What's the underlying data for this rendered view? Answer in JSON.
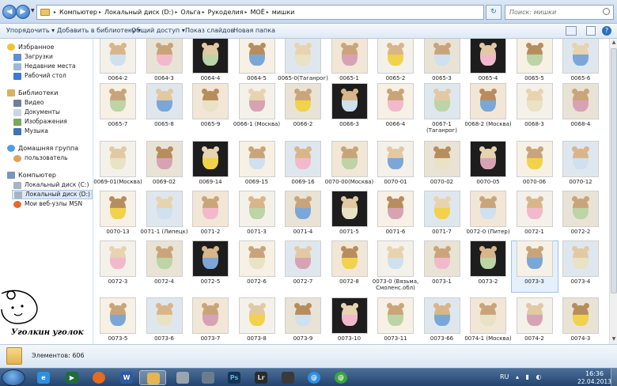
{
  "address": {
    "breadcrumbs": [
      "Компьютер",
      "Локальный диск (D:)",
      "Ольга",
      "Рукоделия",
      "МОЁ",
      "мишки"
    ],
    "search_placeholder": "Поиск: мишки"
  },
  "toolbar": {
    "organize": "Упорядочить ▾",
    "add_to_library": "Добавить в библиотеку ▾",
    "share": "Общий доступ ▾",
    "slideshow": "Показ слайдов",
    "new_folder": "Новая папка"
  },
  "nav": {
    "favorites": {
      "title": "Избранное",
      "items": [
        "Загрузки",
        "Недавние места",
        "Рабочий стол"
      ]
    },
    "libraries": {
      "title": "Библиотеки",
      "items": [
        "Видео",
        "Документы",
        "Изображения",
        "Музыка"
      ]
    },
    "homegroup": {
      "title": "Домашняя группа",
      "items": [
        "пользователь"
      ]
    },
    "computer": {
      "title": "Компьютер",
      "items": [
        "Локальный диск (C:)",
        "Локальный диск (D:)",
        "Мои веб-узлы MSN"
      ]
    }
  },
  "sticker": {
    "text": "Уголкин уголок"
  },
  "files": [
    [
      "0064-2",
      "0064-3",
      "0064-4",
      "0064-5",
      "0065-0(Таганрог)",
      "0065-1",
      "0065-2",
      "0065-3",
      "0065-4",
      "0065-5",
      "0065-6"
    ],
    [
      "0065-7",
      "0065-8",
      "0065-9",
      "0066-1 (Москва)",
      "0066-2",
      "0066-3",
      "0066-4",
      "0067-1 (Таганрог)",
      "0068-2 (Москва)",
      "0068-3",
      "0068-4"
    ],
    [
      "0069-01(Москва)",
      "0069-02",
      "0069-14",
      "0069-15",
      "0069-16",
      "0070-00(Москва)",
      "0070-01",
      "0070-02",
      "0070-05",
      "0070-06",
      "0070-12"
    ],
    [
      "0070-13",
      "0071-1 (Липецк)",
      "0071-2",
      "0071-3",
      "0071-4",
      "0071-5",
      "0071-6",
      "0071-7",
      "0072-0 (Питер)",
      "0072-1",
      "0072-2"
    ],
    [
      "0072-3",
      "0072-4",
      "0072-5",
      "0072-6",
      "0072-7",
      "0072-8",
      "0073-0 (Вязьма, Смоленс.обл)",
      "0073-1",
      "0073-2",
      "0073-3",
      "0073-4"
    ],
    [
      "0073-5",
      "0073-6",
      "0073-7",
      "0073-8",
      "0073-9",
      "0073-10",
      "0073-11",
      "0073-66",
      "0074-1 (Москва)",
      "0074-2",
      "0074-3"
    ]
  ],
  "details": {
    "item_count": "Элементов: 606"
  },
  "taskbar": {
    "apps": [
      "internet-explorer",
      "media-player",
      "firefox",
      "word",
      "explorer",
      "printer",
      "photoshop",
      "lightroom",
      "messenger",
      "icq"
    ],
    "active_app": "explorer",
    "lang": "RU",
    "time": "16:36",
    "date": "22.04.2013"
  },
  "colors": {
    "accent": "#2d6fbf",
    "taskbar": "#2a4a73",
    "selection": "#e5f0fb"
  }
}
